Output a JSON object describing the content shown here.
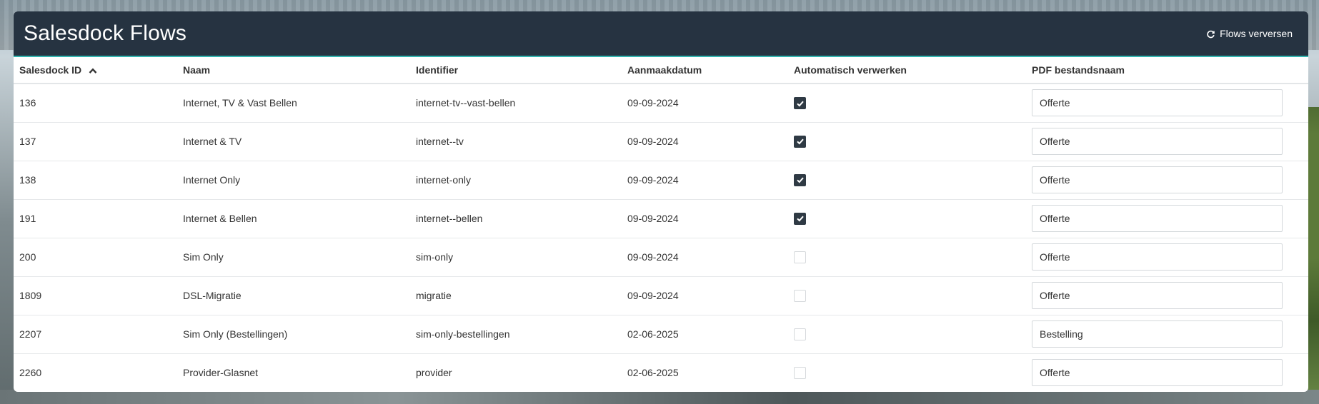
{
  "header": {
    "title": "Salesdock Flows",
    "refresh_label": "Flows verversen"
  },
  "table": {
    "columns": [
      {
        "label": "Salesdock ID",
        "sorted": "ascending"
      },
      {
        "label": "Naam"
      },
      {
        "label": "Identifier"
      },
      {
        "label": "Aanmaakdatum"
      },
      {
        "label": "Automatisch verwerken"
      },
      {
        "label": "PDF bestandsnaam"
      }
    ],
    "rows": [
      {
        "id": "136",
        "naam": "Internet, TV & Vast Bellen",
        "identifier": "internet-tv--vast-bellen",
        "datum": "09-09-2024",
        "auto": true,
        "pdf": "Offerte"
      },
      {
        "id": "137",
        "naam": "Internet & TV",
        "identifier": "internet--tv",
        "datum": "09-09-2024",
        "auto": true,
        "pdf": "Offerte"
      },
      {
        "id": "138",
        "naam": "Internet Only",
        "identifier": "internet-only",
        "datum": "09-09-2024",
        "auto": true,
        "pdf": "Offerte"
      },
      {
        "id": "191",
        "naam": "Internet & Bellen",
        "identifier": "internet--bellen",
        "datum": "09-09-2024",
        "auto": true,
        "pdf": "Offerte"
      },
      {
        "id": "200",
        "naam": "Sim Only",
        "identifier": "sim-only",
        "datum": "09-09-2024",
        "auto": false,
        "pdf": "Offerte"
      },
      {
        "id": "1809",
        "naam": "DSL-Migratie",
        "identifier": "migratie",
        "datum": "09-09-2024",
        "auto": false,
        "pdf": "Offerte"
      },
      {
        "id": "2207",
        "naam": "Sim Only (Bestellingen)",
        "identifier": "sim-only-bestellingen",
        "datum": "02-06-2025",
        "auto": false,
        "pdf": "Bestelling"
      },
      {
        "id": "2260",
        "naam": "Provider-Glasnet",
        "identifier": "provider",
        "datum": "02-06-2025",
        "auto": false,
        "pdf": "Offerte"
      }
    ]
  },
  "colors": {
    "header_bg": "#263341",
    "accent": "#33b5b0",
    "checkbox_checked": "#2f3a44"
  },
  "icons": {
    "refresh": "refresh-icon",
    "sort": "chevron-up-icon",
    "check": "check-icon"
  }
}
